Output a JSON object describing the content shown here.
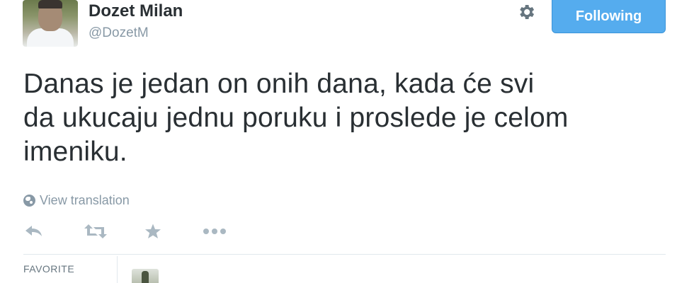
{
  "tweet": {
    "author": {
      "name": "Dozet Milan",
      "handle": "@DozetM"
    },
    "follow_button_label": "Following",
    "text_lines": [
      "Danas je jedan on onih dana, kada će svi",
      "da ukucaju jednu poruku i proslede je celom",
      "imeniku."
    ],
    "translate_label": "View translation",
    "actions": [
      "reply-icon",
      "retweet-icon",
      "favorite-icon",
      "more-icon"
    ],
    "stats": {
      "favorites_label": "FAVORITE"
    }
  },
  "colors": {
    "accent": "#55acee",
    "muted": "#8899a6",
    "text": "#292f33"
  }
}
